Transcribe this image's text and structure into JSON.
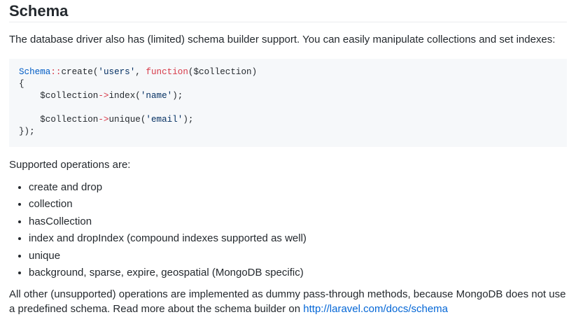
{
  "heading": "Schema",
  "intro": "The database driver also has (limited) schema builder support. You can easily manipulate collections and set indexes:",
  "code": {
    "line1": {
      "class_name": "Schema",
      "op": "::",
      "method": "create(",
      "string": "'users'",
      "sep": ", ",
      "keyword": "function",
      "rest": "($collection)"
    },
    "line2": "{",
    "line3": {
      "indent": "    ",
      "var": "$collection",
      "op": "->",
      "method": "index(",
      "string": "'name'",
      "rest": ");"
    },
    "line5": {
      "indent": "    ",
      "var": "$collection",
      "op": "->",
      "method": "unique(",
      "string": "'email'",
      "rest": ");"
    },
    "line6": "});"
  },
  "supported_label": "Supported operations are:",
  "operations": [
    "create and drop",
    "collection",
    "hasCollection",
    "index and dropIndex (compound indexes supported as well)",
    "unique",
    "background, sparse, expire, geospatial (MongoDB specific)"
  ],
  "outro": {
    "text": "All other (unsupported) operations are implemented as dummy pass-through methods, because MongoDB does not use a predefined schema. Read more about the schema builder on ",
    "link_text": "http://laravel.com/docs/schema"
  }
}
